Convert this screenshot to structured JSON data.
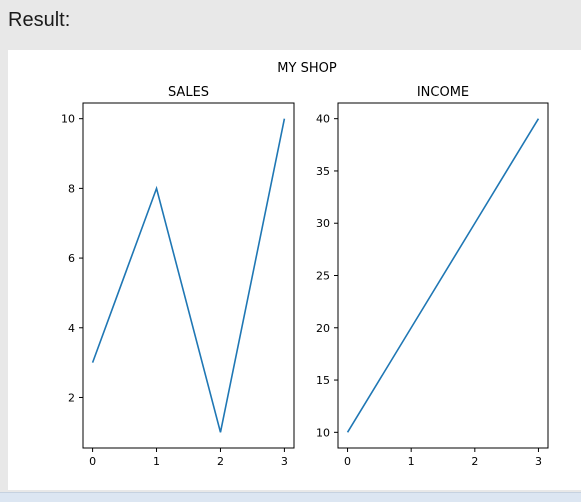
{
  "output": {
    "label": "Result:"
  },
  "figure": {
    "suptitle": "MY SHOP"
  },
  "colors": {
    "line": "#1f77b4",
    "axes": "#000000",
    "figure_bg": "#ffffff",
    "panel_bg": "#e8e8e8"
  },
  "chart_data": [
    {
      "type": "line",
      "title": "SALES",
      "xlabel": "",
      "ylabel": "",
      "x": [
        0,
        1,
        2,
        3
      ],
      "series": [
        {
          "values": [
            3,
            8,
            1,
            10
          ]
        }
      ],
      "xlim": [
        -0.15,
        3.15
      ],
      "ylim": [
        0.55,
        10.45
      ],
      "xticks": [
        0,
        1,
        2,
        3
      ],
      "yticks": [
        2,
        4,
        6,
        8,
        10
      ],
      "grid": false
    },
    {
      "type": "line",
      "title": "INCOME",
      "xlabel": "",
      "ylabel": "",
      "x": [
        0,
        1,
        2,
        3
      ],
      "series": [
        {
          "values": [
            10,
            20,
            30,
            40
          ]
        }
      ],
      "xlim": [
        -0.15,
        3.15
      ],
      "ylim": [
        8.5,
        41.5
      ],
      "xticks": [
        0,
        1,
        2,
        3
      ],
      "yticks": [
        10,
        15,
        20,
        25,
        30,
        35,
        40
      ],
      "grid": false
    }
  ]
}
